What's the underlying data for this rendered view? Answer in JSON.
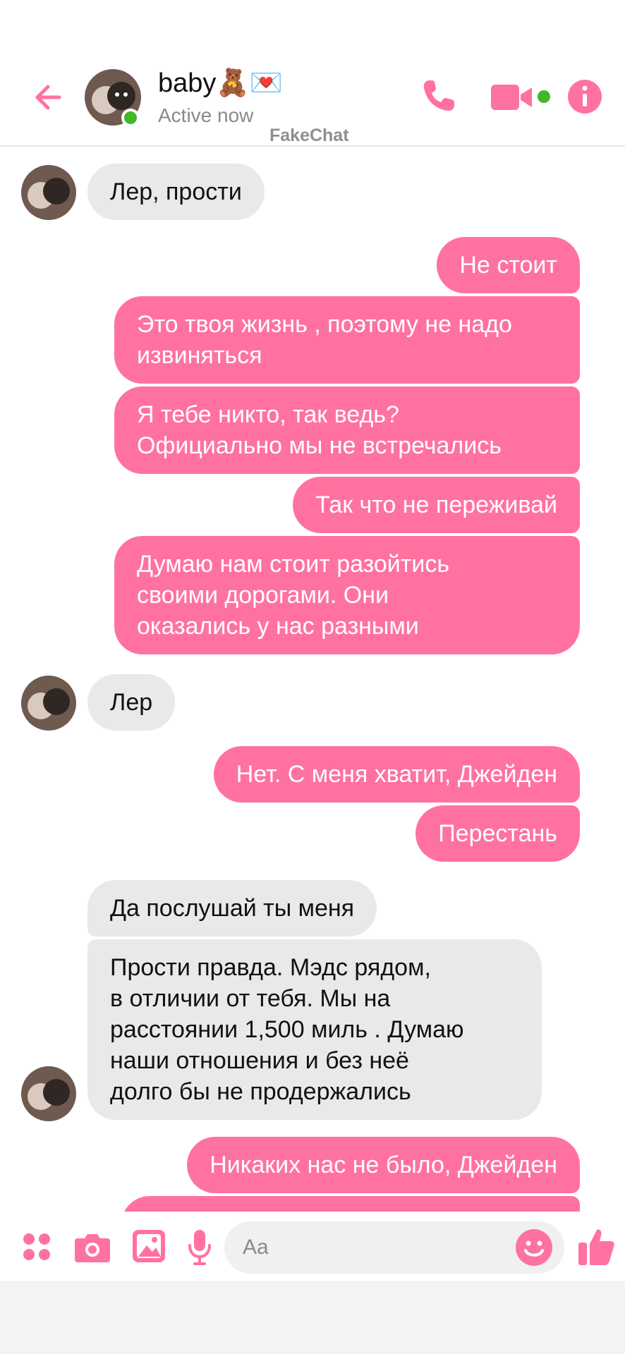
{
  "header": {
    "contact_name": "baby🧸💌",
    "status": "Active now",
    "watermark": "FakeChat"
  },
  "colors": {
    "accent": "#ff729f",
    "incoming": "#e9e9eb",
    "online": "#42b72a"
  },
  "icons": [
    "back-arrow-icon",
    "phone-icon",
    "video-camera-icon",
    "info-icon",
    "apps-grid-icon",
    "camera-icon",
    "image-icon",
    "microphone-icon",
    "emoji-icon",
    "thumbs-up-icon"
  ],
  "messages": [
    {
      "side": "in",
      "text": "Лер, прости",
      "avatar": true
    },
    {
      "side": "out",
      "text": "Не стоит"
    },
    {
      "side": "out",
      "text": "Это твоя жизнь , поэтому не надо\nизвиняться"
    },
    {
      "side": "out",
      "text": "Я тебе никто, так ведь?\nОфициально мы не встречались"
    },
    {
      "side": "out",
      "text": "Так что не переживай"
    },
    {
      "side": "out",
      "text": "Думаю нам стоит разойтись\nсвоими дорогами. Они\nоказались у нас разными"
    },
    {
      "side": "in",
      "text": "Лер",
      "avatar": true
    },
    {
      "side": "out",
      "text": "Нет. С меня хватит, Джейден"
    },
    {
      "side": "out",
      "text": "Перестань"
    },
    {
      "side": "in",
      "text": "Да послушай ты меня"
    },
    {
      "side": "in",
      "text": "Прости правда. Мэдс рядом,\nв отличии от тебя. Мы на\nрасстоянии 1,500 миль . Думаю\nнаши отношения и без неё\nдолго бы не продержались",
      "avatar": true
    },
    {
      "side": "out",
      "text": "Никаких нас не было, Джейден"
    }
  ],
  "composer": {
    "placeholder": "Aa"
  }
}
